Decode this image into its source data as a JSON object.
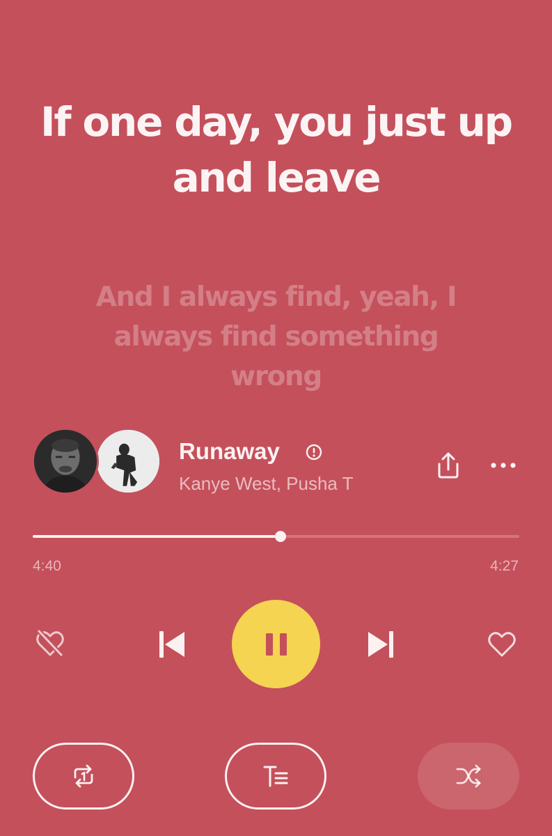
{
  "lyrics": {
    "current": "If one day, you just up and leave",
    "next": "And I always find, yeah, I always find something wrong"
  },
  "track": {
    "title": "Runaway",
    "artists": "Kanye West, Pusha T",
    "explicit": true
  },
  "progress": {
    "elapsed": "4:40",
    "total": "4:27",
    "fraction": 0.51
  },
  "controls": {
    "dislike_icon": "heart-broken-icon",
    "prev_icon": "skip-previous-icon",
    "play_state": "pause",
    "next_icon": "skip-next-icon",
    "like_icon": "heart-icon",
    "repeat_icon": "repeat-one-icon",
    "lyrics_icon": "lyrics-icon",
    "shuffle_icon": "shuffle-icon",
    "shuffle_active": false
  },
  "colors": {
    "background": "#c4505b",
    "accent": "#f5d451",
    "pause_glyph": "#c4505b",
    "text": "#fbf1f1"
  }
}
